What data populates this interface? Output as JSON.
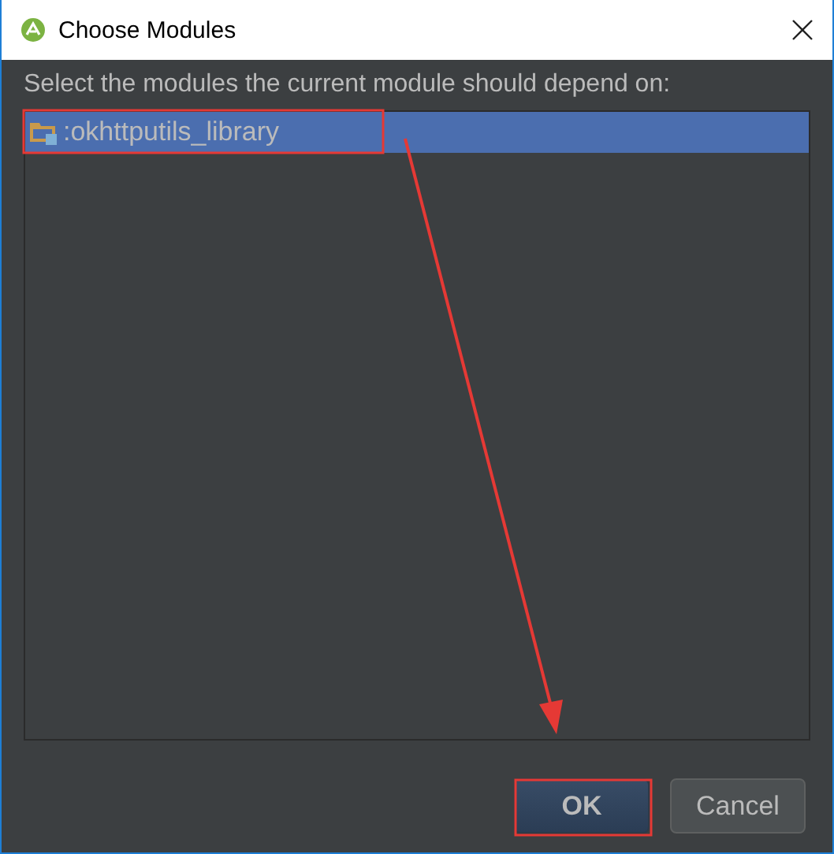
{
  "window": {
    "title": "Choose Modules"
  },
  "prompt": "Select the modules the current module should depend on:",
  "modules": [
    {
      "name": ":okhttputils_library",
      "selected": true
    }
  ],
  "buttons": [
    {
      "label": "OK",
      "default": true
    },
    {
      "label": "Cancel",
      "default": false
    }
  ]
}
